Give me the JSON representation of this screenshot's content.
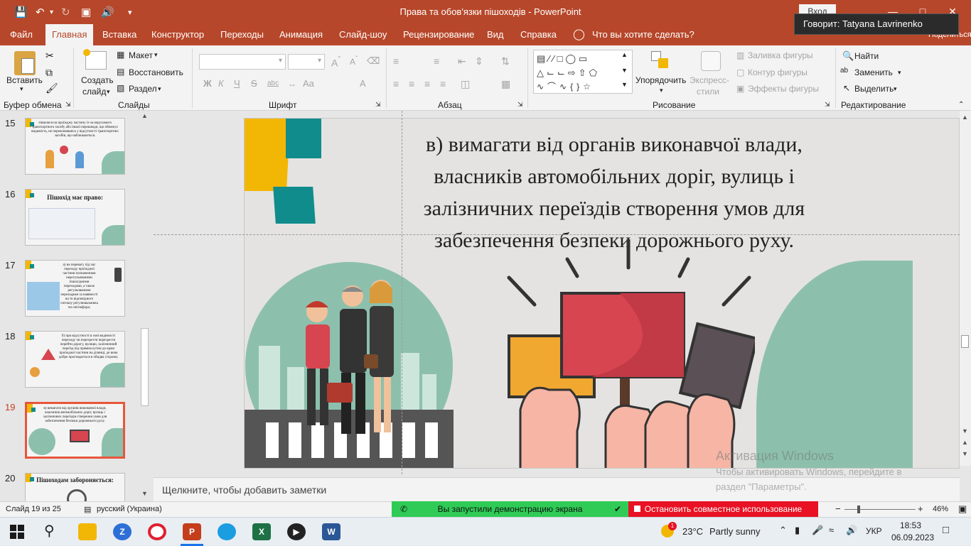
{
  "window": {
    "title": "Права та обов'язки пішоходів  -  PowerPoint",
    "login_label": "Вход",
    "tooltip": "Говорит: Tatyana Lavrinenko",
    "share_label": "Поделиться"
  },
  "tabs": [
    "Файл",
    "Главная",
    "Вставка",
    "Конструктор",
    "Переходы",
    "Анимация",
    "Слайд-шоу",
    "Рецензирование",
    "Вид",
    "Справка"
  ],
  "tell_me": "Что вы хотите сделать?",
  "ribbon": {
    "clipboard": {
      "paste": "Вставить",
      "group": "Буфер обмена"
    },
    "slides": {
      "new_slide_1": "Создать",
      "new_slide_2": "слайд",
      "layout": "Макет",
      "reset": "Восстановить",
      "section": "Раздел",
      "group": "Слайды"
    },
    "font": {
      "group": "Шрифт",
      "bold": "Ж",
      "italic": "К",
      "underline": "Ч",
      "strike": "S",
      "abc": "abc",
      "aa": "Aa",
      "a": "A"
    },
    "paragraph": {
      "group": "Абзац"
    },
    "drawing": {
      "arrange": "Упорядочить",
      "quick_styles_1": "Экспресс-",
      "quick_styles_2": "стили",
      "fill": "Заливка фигуры",
      "outline": "Контур фигуры",
      "effects": "Эффекты фигуры",
      "group": "Рисование"
    },
    "editing": {
      "find": "Найти",
      "replace": "Заменить",
      "select": "Выделить",
      "group": "Редактирование"
    }
  },
  "slides": [
    {
      "num": "15",
      "text": "з'явилися на проїжджу частину із-за нерухомого транспортного засобу або іншої перешкоди, що обмежує видимість, не переконавшись у відсутності транспортних засобів, що наближаються."
    },
    {
      "num": "16",
      "text": "Пішохід має право:"
    },
    {
      "num": "17",
      "text": "а) на перевагу під час переходу проїжджої частини позначеними нерегульованими пішохідними переходами, а також регульованими переходами за наявності на то відповідного сигналу регулювальника чи світлофора;"
    },
    {
      "num": "18",
      "text": "б) при відсутності в зоні видимості переходу чи перехрестя перехрестя перейти дорогу, вулицю, залізничний переїзд під прямим кутом до краю проїжджої частини на ділянці, де вона добре проглядається в обидва сторони;"
    },
    {
      "num": "19",
      "text": "в) вимагати від органів виконавчої влади, власників автомобільних доріг, вулиць і залізничних переїздів створення умов для забезпечення безпеки дорожнього руху."
    },
    {
      "num": "20",
      "text": "Пішоходам забороняється:"
    }
  ],
  "current_slide": {
    "lines": [
      "в) вимагати від органів виконавчої влади,",
      "власників автомобільних доріг, вулиць і",
      "залізничних переїздів створення умов для",
      "забезпечення безпеки дорожнього руху."
    ]
  },
  "notes_placeholder": "Щелкните, чтобы добавить заметки",
  "watermark": {
    "title": "Активация Windows",
    "line1": "Чтобы активировать Windows, перейдите в",
    "line2": "раздел \"Параметры\"."
  },
  "status": {
    "slide_info": "Слайд 19 из 25",
    "language": "русский (Украина)",
    "screen_share": "Вы запустили демонстрацию экрана",
    "stop_share": "Остановить совместное использование",
    "zoom": "46%"
  },
  "taskbar": {
    "weather_temp": "23°C",
    "weather_desc": "Partly sunny",
    "lang": "УКР",
    "time": "18:53",
    "date": "06.09.2023",
    "weather_badge": "1"
  },
  "colors": {
    "accent": "#b7472a",
    "teal": "#118c8c",
    "yellow": "#f2b705",
    "sage": "#8cc0ad",
    "sign_red": "#d64550",
    "green_bar": "#2fcb56",
    "red_bar": "#e81224"
  }
}
